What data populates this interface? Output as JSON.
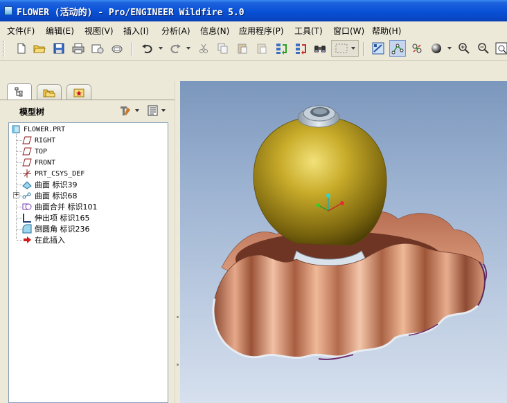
{
  "window": {
    "title": "FLOWER (活动的) - Pro/ENGINEER Wildfire 5.0"
  },
  "menu": {
    "items": [
      "文件(F)",
      "编辑(E)",
      "视图(V)",
      "插入(I)",
      "分析(A)",
      "信息(N)",
      "应用程序(P)",
      "工具(T)",
      "窗口(W)",
      "帮助(H)"
    ]
  },
  "toolbar": {
    "buttons": [
      "new-file",
      "open-folder",
      "save",
      "print",
      "send-mail",
      "send-mail-2",
      "undo",
      "redo",
      "cut",
      "copy",
      "paste",
      "paste-special",
      "regenerate",
      "regenerate-manager",
      "find",
      "select-box",
      "view-manager",
      "datum-display",
      "spin-center",
      "shading",
      "zoom-in",
      "zoom-out",
      "refit"
    ]
  },
  "panel": {
    "tabs": [
      "model-tree",
      "folder-browser",
      "favorites"
    ],
    "title": "模型树"
  },
  "tree": {
    "root": "FLOWER.PRT",
    "items": [
      {
        "label": "RIGHT",
        "icon": "datum-plane-icon"
      },
      {
        "label": "TOP",
        "icon": "datum-plane-icon"
      },
      {
        "label": "FRONT",
        "icon": "datum-plane-icon"
      },
      {
        "label": "PRT_CSYS_DEF",
        "icon": "csys-icon"
      },
      {
        "label": "曲面 标识39",
        "icon": "surface-icon"
      },
      {
        "label": "曲面 标识68",
        "icon": "surface-icon",
        "expandable": true
      },
      {
        "label": "曲面合并 标识101",
        "icon": "merge-icon"
      },
      {
        "label": "伸出项 标识165",
        "icon": "protrusion-icon"
      },
      {
        "label": "倒圆角 标识236",
        "icon": "round-icon"
      },
      {
        "label": "在此插入",
        "icon": "insert-here-icon"
      }
    ]
  },
  "colors": {
    "titlebar": "#0a52d8",
    "vase_gold": "#b59a1a",
    "petals_copper": "#d28c6e",
    "viewport_top": "#7c97bd",
    "viewport_bottom": "#d6e0ee"
  }
}
